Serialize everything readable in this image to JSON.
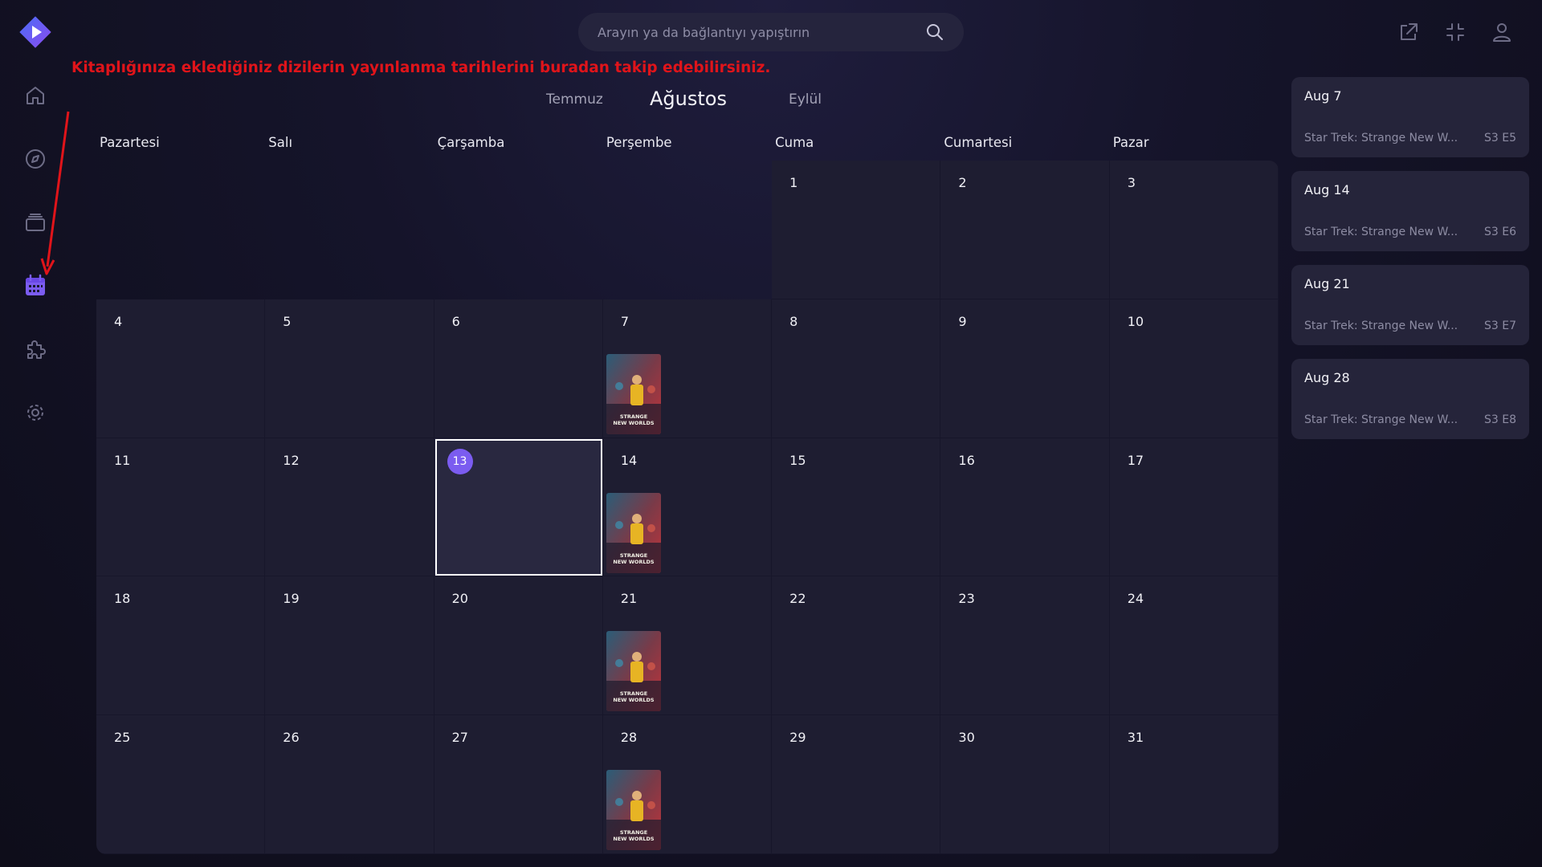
{
  "search": {
    "placeholder": "Arayın ya da bağlantıyı yapıştırın"
  },
  "annotation": {
    "text": "Kitaplığınıza eklediğiniz dizilerin yayınlanma tarihlerini buradan takip edebilirsiniz."
  },
  "sidebar": {
    "items": [
      {
        "name": "home-icon"
      },
      {
        "name": "compass-icon"
      },
      {
        "name": "library-icon"
      },
      {
        "name": "calendar-icon",
        "active": true
      },
      {
        "name": "puzzle-icon"
      },
      {
        "name": "gear-icon"
      }
    ]
  },
  "calendar": {
    "prev_month": "Temmuz",
    "current_month": "Ağustos",
    "next_month": "Eylül",
    "weekdays": [
      "Pazartesi",
      "Salı",
      "Çarşamba",
      "Perşembe",
      "Cuma",
      "Cumartesi",
      "Pazar"
    ],
    "today": "13",
    "leading_empty_days": 4,
    "days": [
      "1",
      "2",
      "3",
      "4",
      "5",
      "6",
      "7",
      "8",
      "9",
      "10",
      "11",
      "12",
      "13",
      "14",
      "15",
      "16",
      "17",
      "18",
      "19",
      "20",
      "21",
      "22",
      "23",
      "24",
      "25",
      "26",
      "27",
      "28",
      "29",
      "30",
      "31"
    ],
    "poster_days": [
      "7",
      "14",
      "21",
      "28"
    ],
    "poster_title": "STAR TREK STRANGE NEW WORLDS"
  },
  "episodes": [
    {
      "date": "Aug 7",
      "title": "Star Trek: Strange New W...",
      "ep": "S3 E5"
    },
    {
      "date": "Aug 14",
      "title": "Star Trek: Strange New W...",
      "ep": "S3 E6"
    },
    {
      "date": "Aug 21",
      "title": "Star Trek: Strange New W...",
      "ep": "S3 E7"
    },
    {
      "date": "Aug 28",
      "title": "Star Trek: Strange New W...",
      "ep": "S3 E8"
    }
  ],
  "colors": {
    "accent": "#7b5cf0",
    "annotation": "#e0141a",
    "active_nav": "#7b5cf0",
    "icon": "#6d6c86"
  }
}
